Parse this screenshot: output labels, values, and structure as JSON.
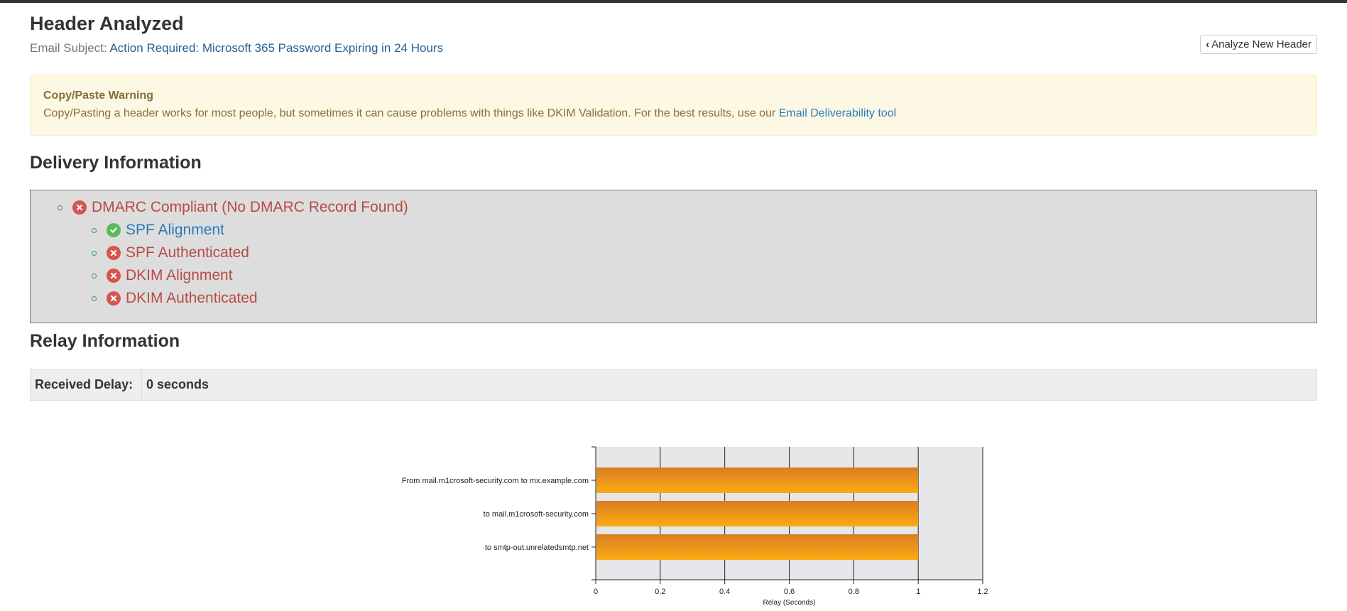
{
  "header": {
    "title": "Header Analyzed",
    "subject_label": "Email Subject:",
    "subject_value": "Action Required: Microsoft 365 Password Expiring in 24 Hours",
    "analyze_button": "Analyze New Header"
  },
  "warning": {
    "title": "Copy/Paste Warning",
    "text": "Copy/Pasting a header works for most people, but sometimes it can cause problems with things like DKIM Validation. For the best results, use our",
    "link": "Email Deliverability tool"
  },
  "delivery": {
    "heading": "Delivery Information",
    "items": [
      {
        "label": "DMARC Compliant (No DMARC Record Found)",
        "status": "fail"
      },
      {
        "label": "SPF Alignment",
        "status": "pass"
      },
      {
        "label": "SPF Authenticated",
        "status": "fail"
      },
      {
        "label": "DKIM Alignment",
        "status": "fail"
      },
      {
        "label": "DKIM Authenticated",
        "status": "fail"
      }
    ]
  },
  "relay": {
    "heading": "Relay Information",
    "received_delay_label": "Received Delay:",
    "received_delay_value": "0 seconds"
  },
  "chart_data": {
    "type": "bar",
    "orientation": "horizontal",
    "categories": [
      "From mail.m1crosoft-security.com to mx.example.com",
      "to mail.m1crosoft-security.com",
      "to smtp-out.unrelatedsmtp.net"
    ],
    "values": [
      1,
      1,
      1
    ],
    "xlabel": "Relay (Seconds)",
    "xlim": [
      0,
      1.2
    ],
    "xticks": [
      "0",
      "0.2",
      "0.4",
      "0.6",
      "0.8",
      "1",
      "1.2"
    ],
    "grid": true,
    "bar_color": "#f5a21b",
    "plot_bg": "#e6e6e8"
  }
}
